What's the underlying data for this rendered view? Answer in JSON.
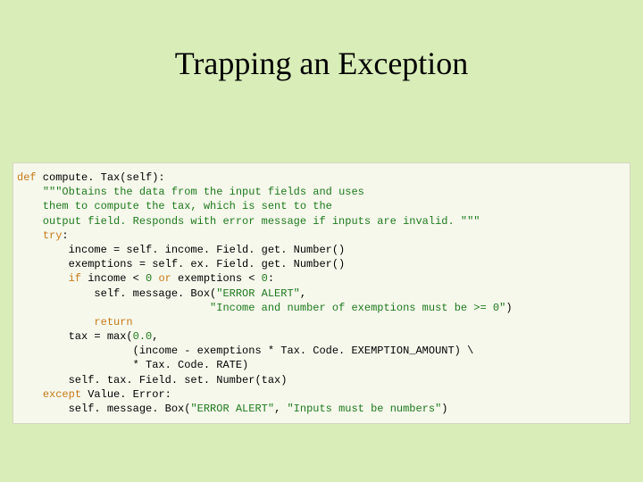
{
  "title": "Trapping an Exception",
  "code": {
    "l01a": "def",
    "l01b": " compute. Tax(self):",
    "l02a": "    ",
    "l02b": "\"\"\"Obtains the data from the input fields and uses",
    "l03": "    them to compute the tax, which is sent to the",
    "l04": "    output field. Responds with error message if inputs are invalid. \"\"\"",
    "l05a": "    ",
    "l05b": "try",
    "l05c": ":",
    "l06": "        income = self. income. Field. get. Number()",
    "l07": "        exemptions = self. ex. Field. get. Number()",
    "l08a": "        ",
    "l08b": "if",
    "l08c": " income < ",
    "l08d": "0",
    "l08e": " ",
    "l08f": "or",
    "l08g": " exemptions < ",
    "l08h": "0",
    "l08i": ":",
    "l09a": "            self. message. Box(",
    "l09b": "\"ERROR ALERT\"",
    "l09c": ",",
    "l10a": "                              ",
    "l10b": "\"Income and number of exemptions must be >= 0\"",
    "l10c": ")",
    "l11a": "            ",
    "l11b": "return",
    "l12a": "        tax = max(",
    "l12b": "0.0",
    "l12c": ",",
    "l13": "                  (income - exemptions * Tax. Code. EXEMPTION_AMOUNT) \\",
    "l14": "                  * Tax. Code. RATE)",
    "l15": "        self. tax. Field. set. Number(tax)",
    "l16a": "    ",
    "l16b": "except",
    "l16c": " Value. Error:",
    "l17a": "        self. message. Box(",
    "l17b": "\"ERROR ALERT\"",
    "l17c": ", ",
    "l17d": "\"Inputs must be numbers\"",
    "l17e": ")"
  }
}
